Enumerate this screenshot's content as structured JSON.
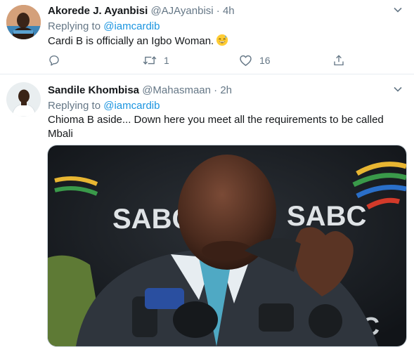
{
  "tweets": [
    {
      "name": "Akorede J. Ayanbisi",
      "handle": "@AJAyanbisi",
      "separator": "·",
      "time": "4h",
      "replying_prefix": "Replying to ",
      "replying_to": "@iamcardib",
      "text": "Cardi B is officially an Igbo Woman.",
      "emoji": "grinning-sweat-emoji",
      "actions": {
        "reply_count": "",
        "retweet_count": "1",
        "like_count": "16"
      }
    },
    {
      "name": "Sandile Khombisa",
      "handle": "@Mahasmaan",
      "separator": "·",
      "time": "2h",
      "replying_prefix": "Replying to ",
      "replying_to": "@iamcardib",
      "text_line1": "Chioma B aside... Down here you meet all the requirements to be called",
      "text_line2": "Mbali",
      "media": {
        "logo_left": "SABC",
        "logo_right": "SABC",
        "logo_bottom": "BC"
      }
    }
  ],
  "colors": {
    "link": "#1b95e0",
    "secondary_text": "#657786",
    "primary_text": "#14171a",
    "divider": "#e6ecf0"
  }
}
